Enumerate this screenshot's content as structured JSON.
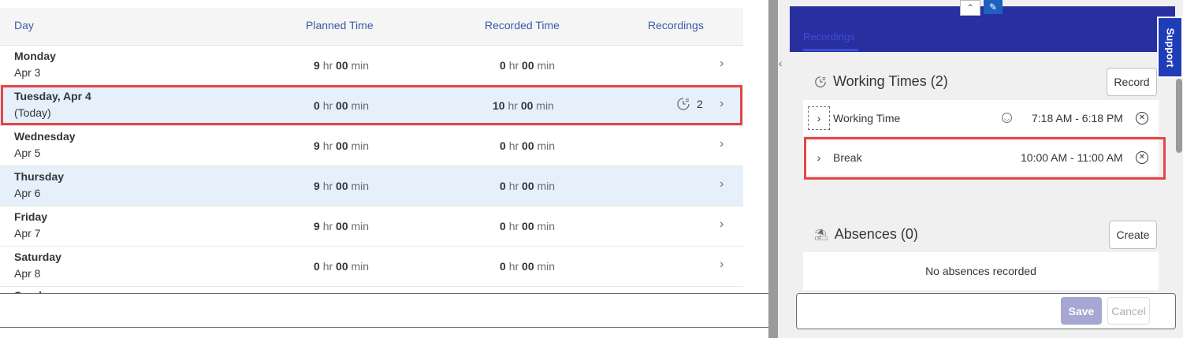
{
  "table": {
    "headers": {
      "day": "Day",
      "planned": "Planned Time",
      "recorded": "Recorded Time",
      "recordings": "Recordings"
    },
    "units": {
      "hr": "hr",
      "min": "min"
    },
    "rows": [
      {
        "day": "Monday",
        "date": "Apr 3",
        "planned_h": "9",
        "planned_m": "00",
        "recorded_h": "0",
        "recorded_m": "00",
        "recordings": ""
      },
      {
        "day": "Tuesday, Apr 4",
        "date": "(Today)",
        "planned_h": "0",
        "planned_m": "00",
        "recorded_h": "10",
        "recorded_m": "00",
        "recordings": "2"
      },
      {
        "day": "Wednesday",
        "date": "Apr 5",
        "planned_h": "9",
        "planned_m": "00",
        "recorded_h": "0",
        "recorded_m": "00",
        "recordings": ""
      },
      {
        "day": "Thursday",
        "date": "Apr 6",
        "planned_h": "9",
        "planned_m": "00",
        "recorded_h": "0",
        "recorded_m": "00",
        "recordings": ""
      },
      {
        "day": "Friday",
        "date": "Apr 7",
        "planned_h": "9",
        "planned_m": "00",
        "recorded_h": "0",
        "recorded_m": "00",
        "recordings": ""
      },
      {
        "day": "Saturday",
        "date": "Apr 8",
        "planned_h": "0",
        "planned_m": "00",
        "recorded_h": "0",
        "recorded_m": "00",
        "recordings": ""
      }
    ],
    "partial_row": "Sunday"
  },
  "panel": {
    "tab": "Recordings",
    "support": "Support",
    "working_times": {
      "title": "Working Times (2)",
      "record_button": "Record",
      "items": [
        {
          "label": "Working Time",
          "time": "7:18 AM - 6:18 PM"
        },
        {
          "label": "Break",
          "time": "10:00 AM - 11:00 AM"
        }
      ]
    },
    "absences": {
      "title": "Absences (0)",
      "create_button": "Create",
      "empty_text": "No absences recorded"
    },
    "footer": {
      "save": "Save",
      "cancel": "Cancel"
    }
  },
  "colors": {
    "accent": "#2a2fa0",
    "highlight": "#e64545",
    "selected_row": "#e5f0fa"
  },
  "icons": [
    "chevron-right-icon",
    "working-time-icon",
    "absence-icon",
    "user-icon",
    "remove-icon",
    "pin-icon",
    "chevron-up-icon"
  ]
}
